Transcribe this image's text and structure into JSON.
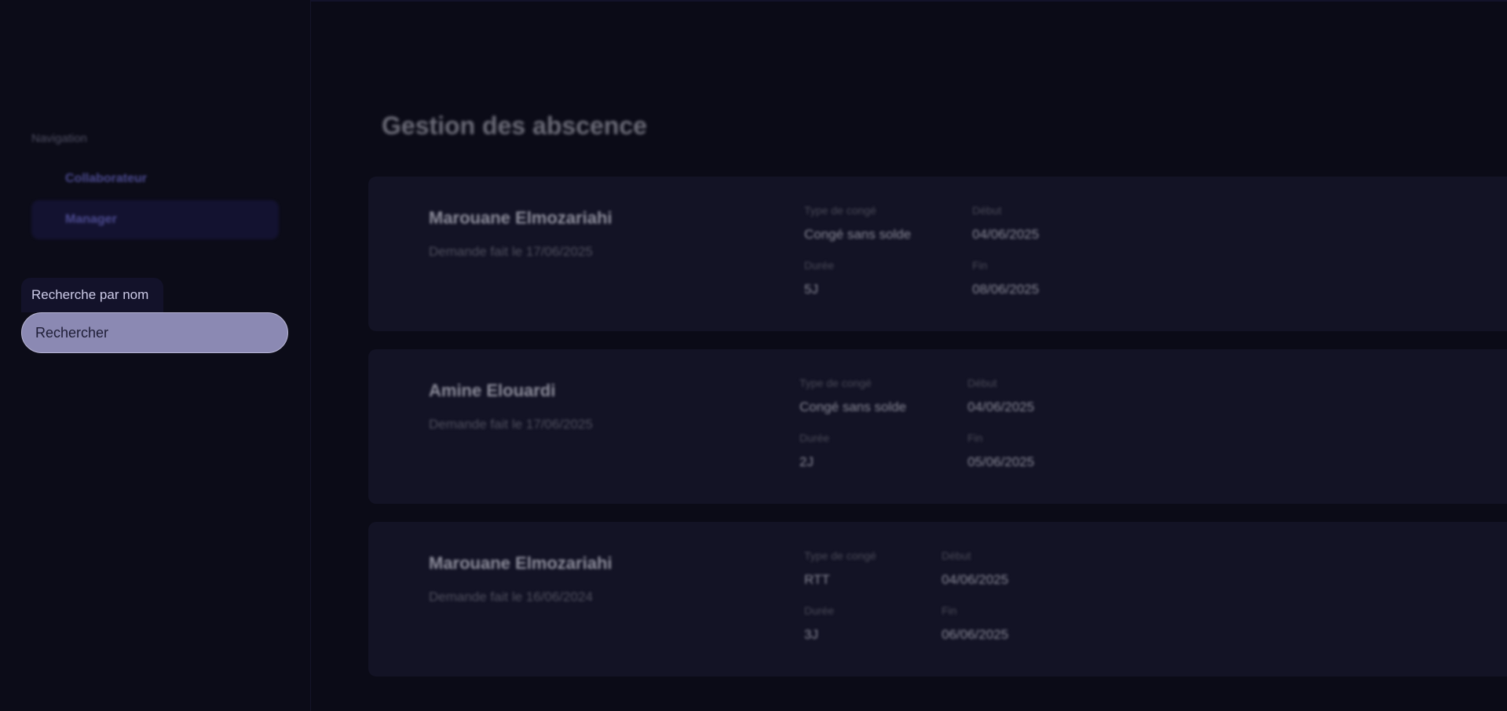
{
  "sidebar": {
    "heading": "Navigation",
    "items": [
      {
        "label": "Collaborateur",
        "active": false
      },
      {
        "label": "Manager",
        "active": true
      }
    ],
    "search": {
      "label": "Recherche par nom",
      "placeholder": "Rechercher"
    }
  },
  "main": {
    "title": "Gestion des abscence",
    "field_labels": {
      "type": "Type de congé",
      "start": "Début",
      "duration": "Durée",
      "end": "Fin"
    },
    "requests": [
      {
        "name": "Marouane Elmozariahi",
        "requested": "Demande fait le 17/06/2025",
        "type": "Congé sans solde",
        "start": "04/06/2025",
        "duration": "5J",
        "end": "08/06/2025"
      },
      {
        "name": "Amine Elouardi",
        "requested": "Demande fait le 17/06/2025",
        "type": "Congé sans solde",
        "start": "04/06/2025",
        "duration": "2J",
        "end": "05/06/2025"
      },
      {
        "name": "Marouane Elmozariahi",
        "requested": "Demande fait le 16/06/2024",
        "type": "RTT",
        "start": "04/06/2025",
        "duration": "3J",
        "end": "06/06/2025"
      }
    ]
  },
  "colors": {
    "background": "#0b0b17",
    "card": "#131325",
    "accent": "#4c4b90",
    "search_fill": "#8b89b3"
  }
}
